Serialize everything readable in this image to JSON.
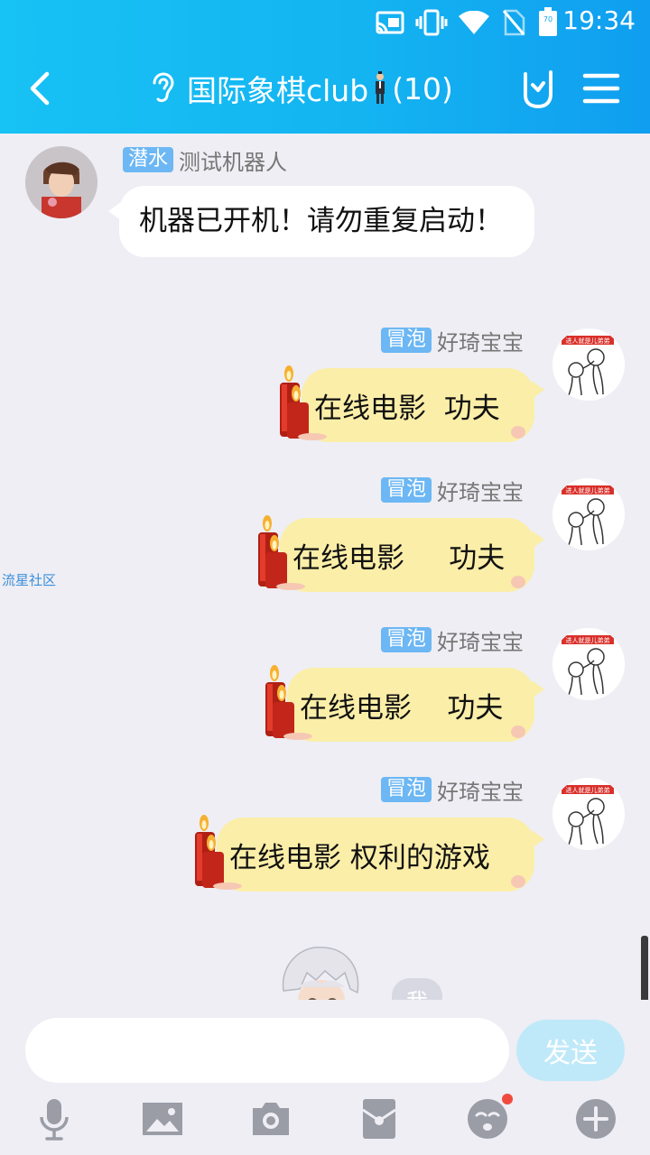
{
  "status_bar": {
    "time": "19:34",
    "battery_level": "70"
  },
  "header": {
    "title": "国际象棋club",
    "member_count": "(10)"
  },
  "messages": {
    "m1": {
      "role_tag": "潜水",
      "sender": "测试机器人",
      "text": "机器已开机！请勿重复启动！"
    },
    "m2": {
      "role_tag": "冒泡",
      "sender": "好琦宝宝",
      "text": "在线电影  功夫"
    },
    "m3": {
      "role_tag": "冒泡",
      "sender": "好琦宝宝",
      "text": "在线电影     功夫"
    },
    "m4": {
      "role_tag": "冒泡",
      "sender": "好琦宝宝",
      "text": "在线电影    功夫"
    },
    "m5": {
      "role_tag": "冒泡",
      "sender": "好琦宝宝",
      "text": "在线电影 权利的游戏"
    },
    "m6": {
      "text": "我"
    }
  },
  "avatar_caption": "进人就是儿弟弟",
  "side_link": "流星社区",
  "input": {
    "placeholder": "",
    "send_label": "发送"
  },
  "colors": {
    "header": "#14b4f1",
    "bubble_self": "#fbeea8",
    "tag": "#6cb7f4",
    "badge": "#f04a3e"
  },
  "icons": [
    "cast-icon",
    "vibrate-icon",
    "wifi-icon",
    "no-sim-icon",
    "battery-icon",
    "back-icon",
    "ear-icon",
    "hand-gesture-icon",
    "menu-icon",
    "microphone-icon",
    "image-icon",
    "camera-icon",
    "red-packet-icon",
    "emoji-icon",
    "plus-icon",
    "candle-icon"
  ]
}
